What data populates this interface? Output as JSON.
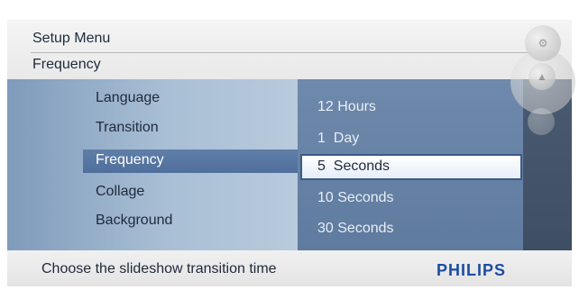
{
  "header": {
    "title": "Setup Menu",
    "subtitle": "Frequency"
  },
  "menu": {
    "items": [
      {
        "label": "Language"
      },
      {
        "label": "Transition"
      },
      {
        "label": "Frequency",
        "selected": true
      },
      {
        "label": "Collage"
      },
      {
        "label": "Background"
      }
    ]
  },
  "options": {
    "items": [
      {
        "label": "12 Hours"
      },
      {
        "label": "1  Day"
      },
      {
        "label": "5  Seconds",
        "selected": true
      },
      {
        "label": "10 Seconds"
      },
      {
        "label": "30 Seconds"
      }
    ]
  },
  "footer": {
    "hint": "Choose the slideshow transition time",
    "brand": "PHILIPS"
  },
  "colors": {
    "brand": "#1c4da1",
    "selected_bg": "#4f6f9c",
    "option_highlight_border": "#3c5a86"
  },
  "icons": {
    "top_control": "settings-dial-icon",
    "mid_control": "nav-up-icon",
    "small_control": "nav-dot-icon"
  }
}
